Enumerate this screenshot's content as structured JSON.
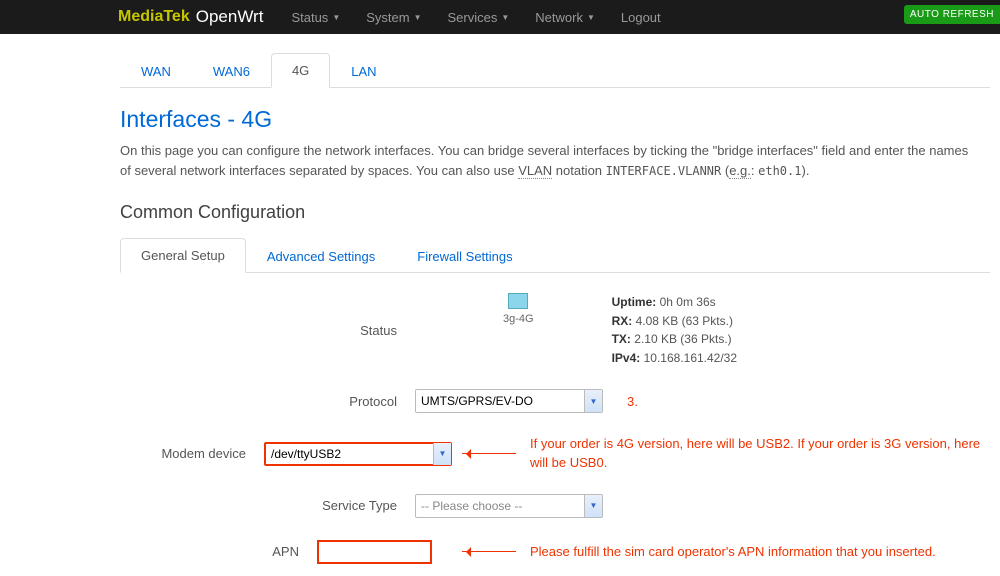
{
  "topbar": {
    "brand1": "MediaTek",
    "brand2": "OpenWrt",
    "menu": [
      "Status",
      "System",
      "Services",
      "Network"
    ],
    "logout": "Logout",
    "auto": "AUTO REFRESH"
  },
  "tabs": {
    "items": [
      "WAN",
      "WAN6",
      "4G",
      "LAN"
    ],
    "active": 2
  },
  "title": "Interfaces - 4G",
  "desc": {
    "t1": "On this page you can configure the network interfaces. You can bridge several interfaces by ticking the \"bridge interfaces\" field and enter the names of several network interfaces separated by spaces. You can also use ",
    "vlan": "VLAN",
    "t2": " notation ",
    "nota": "INTERFACE.VLANNR",
    "t3": " (",
    "eg": "e.g.",
    "t4": ": ",
    "ex": "eth0.1",
    "t5": ")."
  },
  "section": "Common Configuration",
  "subtabs": [
    "General Setup",
    "Advanced Settings",
    "Firewall Settings"
  ],
  "status": {
    "label": "Status",
    "iface": "3g-4G",
    "uptime_l": "Uptime:",
    "uptime": "0h 0m 36s",
    "rx_l": "RX:",
    "rx": "4.08 KB (63 Pkts.)",
    "tx_l": "TX:",
    "tx": "2.10 KB (36 Pkts.)",
    "ip_l": "IPv4:",
    "ip": "10.168.161.42/32"
  },
  "fields": {
    "protocol": {
      "label": "Protocol",
      "value": "UMTS/GPRS/EV-DO"
    },
    "modem": {
      "label": "Modem device",
      "value": "/dev/ttyUSB2"
    },
    "service": {
      "label": "Service Type",
      "value": "-- Please choose --"
    },
    "apn": {
      "label": "APN",
      "value": ""
    }
  },
  "ann": {
    "n": "3.",
    "modem": "If your order is 4G version, here will be USB2. If your order is 3G version, here will be USB0.",
    "apn": "Please fulfill the sim card operator's APN information that you inserted."
  }
}
